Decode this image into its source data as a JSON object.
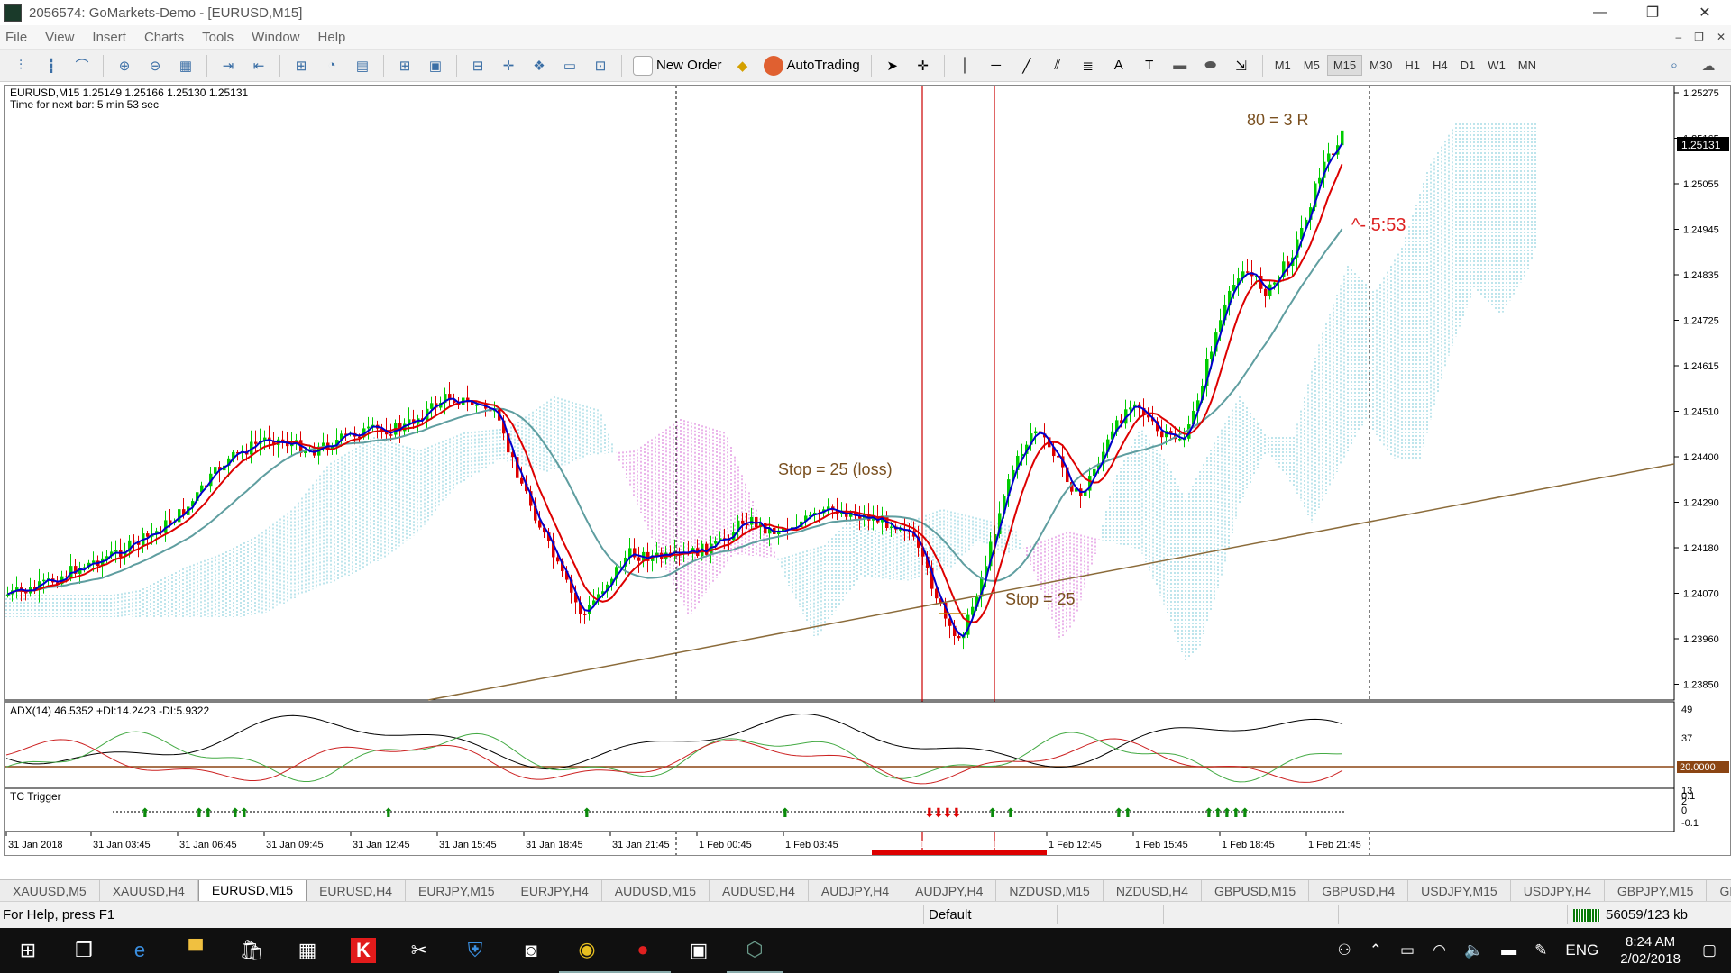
{
  "window": {
    "title": "2056574: GoMarkets-Demo - [EURUSD,M15]"
  },
  "menu": [
    "File",
    "View",
    "Insert",
    "Charts",
    "Tools",
    "Window",
    "Help"
  ],
  "toolbar": {
    "new_order": "New Order",
    "autotrading": "AutoTrading",
    "timeframes": [
      "M1",
      "M5",
      "M15",
      "M30",
      "H1",
      "H4",
      "D1",
      "W1",
      "MN"
    ],
    "active_timeframe": "M15"
  },
  "chart": {
    "header": "EURUSD,M15  1.25149 1.25166 1.25130 1.25131",
    "next_bar": "Time for next bar: 5 min 53 sec",
    "price_ticks": [
      "1.25275",
      "1.25165",
      "1.25055",
      "1.24945",
      "1.24835",
      "1.24725",
      "1.24615",
      "1.24510",
      "1.24400",
      "1.24290",
      "1.24180",
      "1.24070",
      "1.23960",
      "1.23850"
    ],
    "current_price": "1.25131",
    "annotations": {
      "target": "80 = 3 R",
      "countdown": "^- 5:53",
      "stop_loss": "Stop = 25 (loss)",
      "stop": "Stop = 25"
    },
    "adx": {
      "label": "ADX(14) 46.5352 +DI:14.2423 -DI:5.9322",
      "ticks": [
        "49",
        "37",
        "13",
        "2"
      ],
      "level": "20.0000"
    },
    "tc": {
      "label": "TC Trigger",
      "ticks": [
        "0.1",
        "0",
        "-0.1"
      ]
    },
    "time_ticks": [
      "31 Jan 2018",
      "31 Jan 03:45",
      "31 Jan 06:45",
      "31 Jan 09:45",
      "31 Jan 12:45",
      "31 Jan 15:45",
      "31 Jan 18:45",
      "31 Jan 21:45",
      "1 Feb 00:45",
      "1 Feb 03:45",
      "1 Feb 12:45",
      "1 Feb 15:45",
      "1 Feb 18:45",
      "1 Feb 21:45"
    ],
    "time_highlight": "2018.02.01 08:30 1.02.01 11:00",
    "colors": {
      "bull": "#00cc00",
      "bear": "#dd0000",
      "fast_ma": "#0000cc",
      "mid_ma": "#dd0000",
      "slow_ma": "#5f9ea0",
      "cloud_up": "#5fbfd0",
      "cloud_down": "#cc44cc",
      "trendline": "#8b6b3a",
      "annotation": "#7a5020"
    }
  },
  "tabs": [
    "XAUUSD,M5",
    "XAUUSD,H4",
    "EURUSD,M15",
    "EURUSD,H4",
    "EURJPY,M15",
    "EURJPY,H4",
    "AUDUSD,M15",
    "AUDUSD,H4",
    "AUDJPY,H4",
    "AUDJPY,H4",
    "NZDUSD,M15",
    "NZDUSD,H4",
    "GBPUSD,M15",
    "GBPUSD,H4",
    "USDJPY,M15",
    "USDJPY,H4",
    "GBPJPY,M15",
    "GB"
  ],
  "active_tab": "EURUSD,M15",
  "status": {
    "help": "For Help, press F1",
    "profile": "Default",
    "traffic": "56059/123 kb"
  },
  "taskbar": {
    "lang": "ENG",
    "time": "8:24 AM",
    "date": "2/02/2018"
  }
}
